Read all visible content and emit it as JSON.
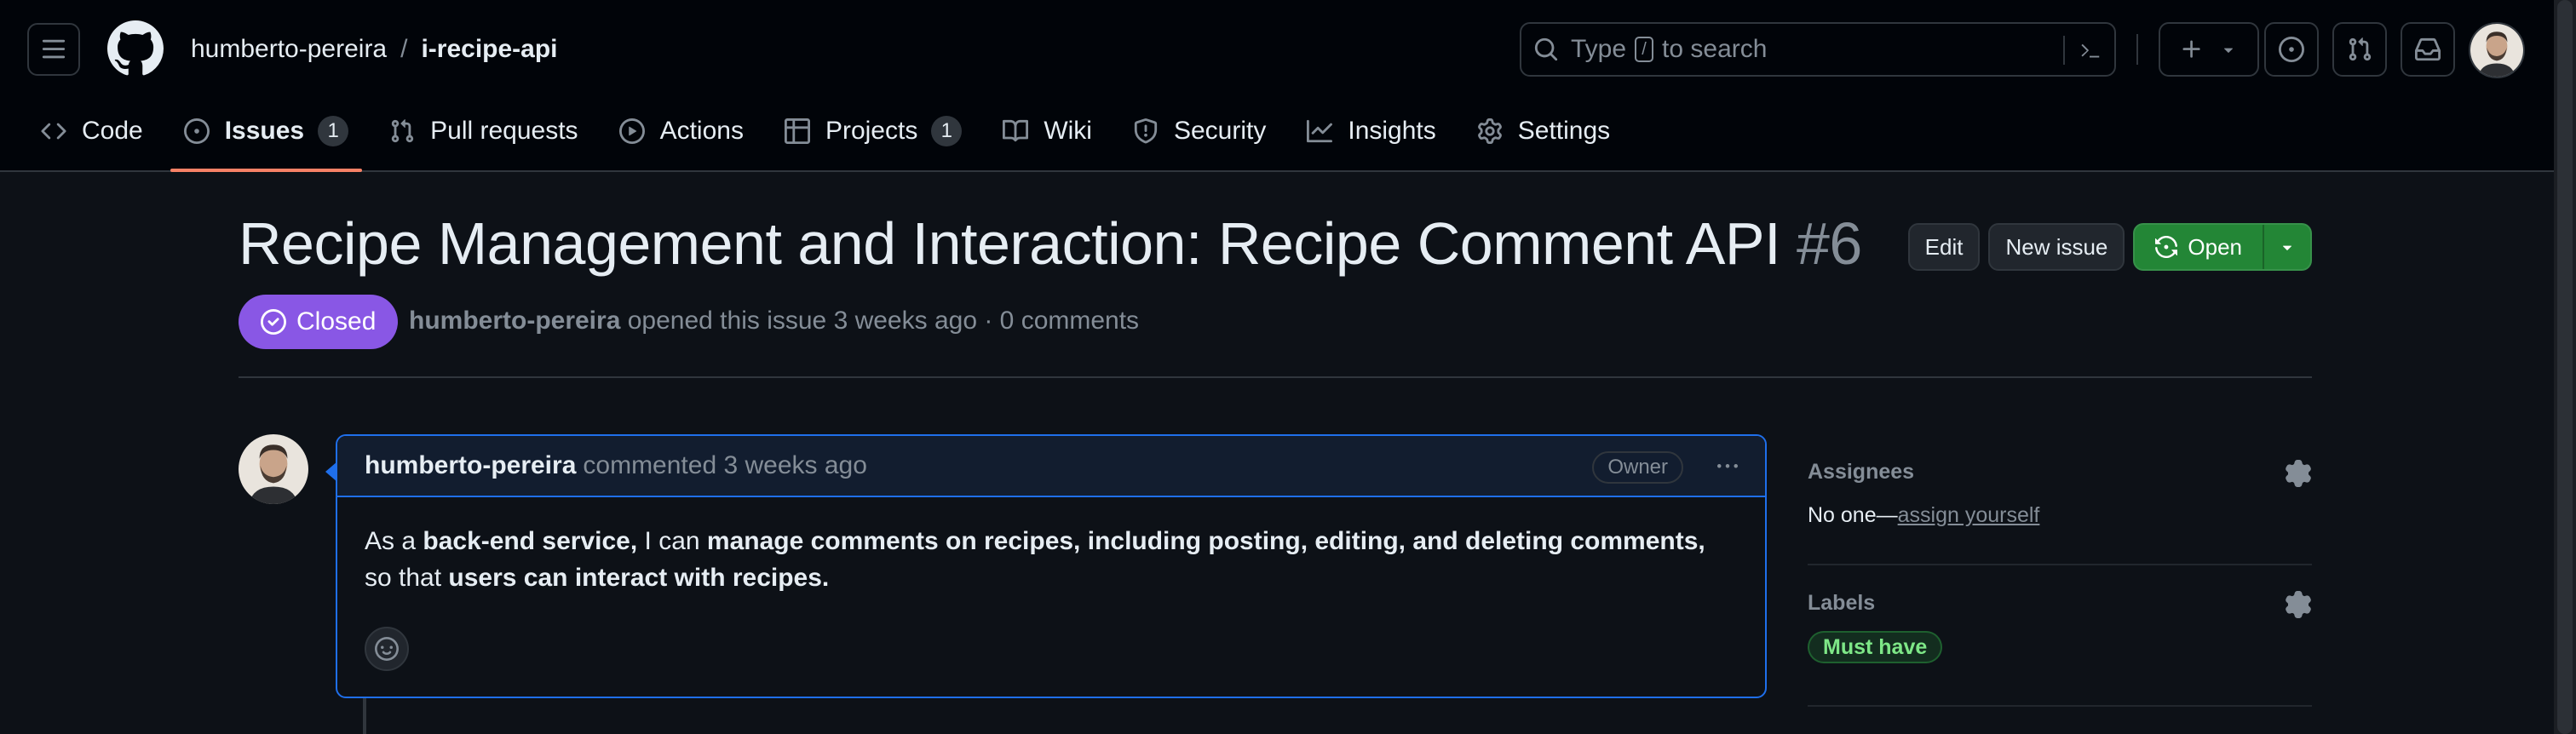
{
  "header": {
    "owner": "humberto-pereira",
    "separator": "/",
    "repo": "i-recipe-api",
    "search": {
      "prefix": "Type",
      "key": "/",
      "suffix": "to search"
    }
  },
  "tabs": [
    {
      "label": "Code",
      "icon": "code-icon"
    },
    {
      "label": "Issues",
      "icon": "issue-opened-icon",
      "count": "1",
      "active": true
    },
    {
      "label": "Pull requests",
      "icon": "git-pull-request-icon"
    },
    {
      "label": "Actions",
      "icon": "play-icon"
    },
    {
      "label": "Projects",
      "icon": "table-icon",
      "count": "1"
    },
    {
      "label": "Wiki",
      "icon": "book-icon"
    },
    {
      "label": "Security",
      "icon": "shield-icon"
    },
    {
      "label": "Insights",
      "icon": "graph-icon"
    },
    {
      "label": "Settings",
      "icon": "gear-icon"
    }
  ],
  "issue": {
    "title": "Recipe Management and Interaction: Recipe Comment API",
    "number": "#6",
    "state": "Closed",
    "author": "humberto-pereira",
    "meta_text": "opened this issue 3 weeks ago · 0 comments",
    "actions": {
      "edit": "Edit",
      "new_issue": "New issue",
      "open": "Open"
    }
  },
  "comment": {
    "author": "humberto-pereira",
    "time_text": "commented 3 weeks ago",
    "role": "Owner",
    "body": {
      "p1": "As a ",
      "b1": "back-end service,",
      "p2": " I can ",
      "b2": "manage comments on recipes, including posting, editing, and deleting comments,",
      "p3": " so that ",
      "b3": "users can interact with recipes."
    }
  },
  "sidebar": {
    "assignees": {
      "title": "Assignees",
      "value": "No one—",
      "link": "assign yourself"
    },
    "labels": {
      "title": "Labels",
      "items": [
        "Must have"
      ]
    }
  },
  "colors": {
    "closed_badge": "#8957e5",
    "open_button": "#238636",
    "tab_underline": "#f78166",
    "label_green": "#7ee787"
  }
}
